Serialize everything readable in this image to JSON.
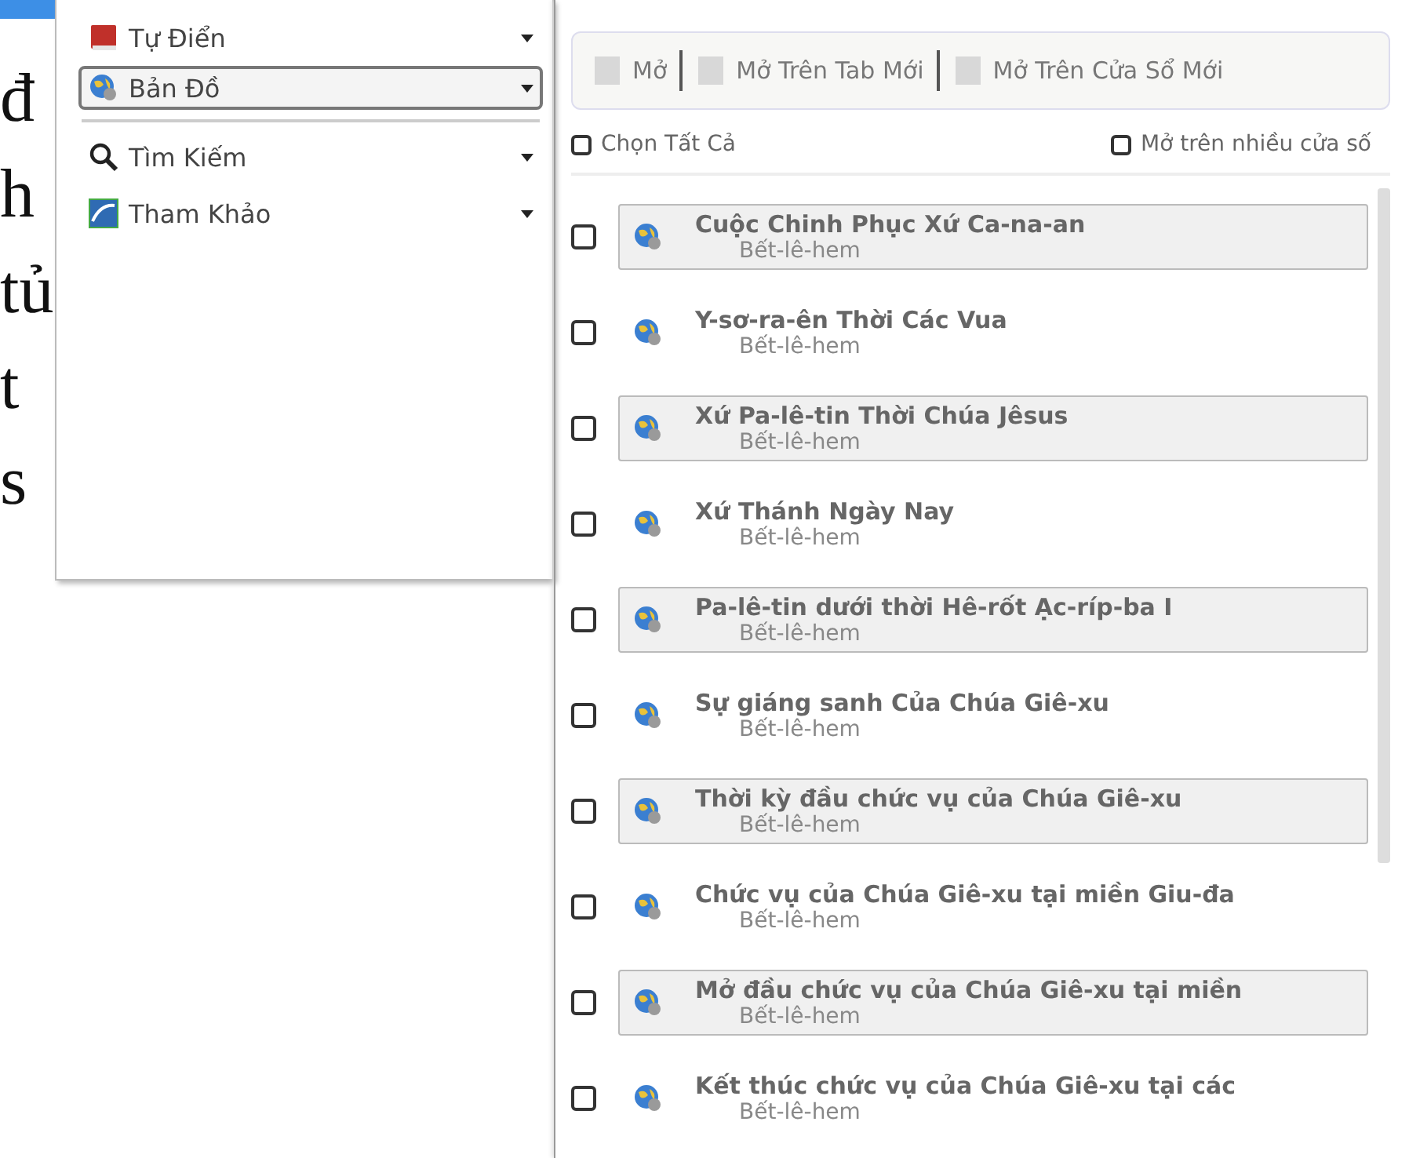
{
  "background_text": [
    "đ",
    "h",
    "tủ",
    "t",
    "s"
  ],
  "menu": {
    "items": [
      {
        "label": "Tự Điển",
        "kind": "dictionary",
        "selected": false
      },
      {
        "label": "Bản Đồ",
        "kind": "map",
        "selected": true
      },
      {
        "label": "Tìm Kiếm",
        "kind": "search",
        "selected": false
      },
      {
        "label": "Tham Khảo",
        "kind": "reference",
        "selected": false
      }
    ]
  },
  "panel": {
    "toolbar": [
      {
        "label": "Mở",
        "disabled": true
      },
      {
        "label": "Mở Trên Tab Mới",
        "disabled": true
      },
      {
        "label": "Mở Trên Cửa Sổ Mới",
        "disabled": true
      }
    ],
    "select_all": {
      "label": "Chọn Tất Cả",
      "checked": false
    },
    "multi_window": {
      "label": "Mở trên nhiều cửa số",
      "checked": false
    },
    "maps": [
      {
        "title": "Cuộc Chinh Phục Xứ Ca-na-an",
        "subtitle": "Bết-lê-hem",
        "checked": false,
        "highlighted": true
      },
      {
        "title": "Y-sơ-ra-ên Thời Các Vua",
        "subtitle": "Bết-lê-hem",
        "checked": false,
        "highlighted": false
      },
      {
        "title": "Xứ Pa-lê-tin Thời Chúa Jêsus",
        "subtitle": "Bết-lê-hem",
        "checked": false,
        "highlighted": true
      },
      {
        "title": "Xứ Thánh Ngày Nay",
        "subtitle": "Bết-lê-hem",
        "checked": false,
        "highlighted": false
      },
      {
        "title": "Pa-lê-tin dưới thời Hê-rốt Ạc-ríp-ba I",
        "subtitle": "Bết-lê-hem",
        "checked": false,
        "highlighted": true
      },
      {
        "title": "Sự giáng sanh Của Chúa Giê-xu",
        "subtitle": "Bết-lê-hem",
        "checked": false,
        "highlighted": false
      },
      {
        "title": "Thời kỳ đầu chức vụ của Chúa Giê-xu",
        "subtitle": "Bết-lê-hem",
        "checked": false,
        "highlighted": true
      },
      {
        "title": "Chức vụ của Chúa Giê-xu tại miền Giu-đa",
        "subtitle": "Bết-lê-hem",
        "checked": false,
        "highlighted": false
      },
      {
        "title": "Mở đầu chức vụ của Chúa Giê-xu tại miền",
        "subtitle": "Bết-lê-hem",
        "checked": false,
        "highlighted": true
      },
      {
        "title": "Kết thúc chức vụ của Chúa Giê-xu tại các",
        "subtitle": "Bết-lê-hem",
        "checked": false,
        "highlighted": false
      }
    ]
  }
}
